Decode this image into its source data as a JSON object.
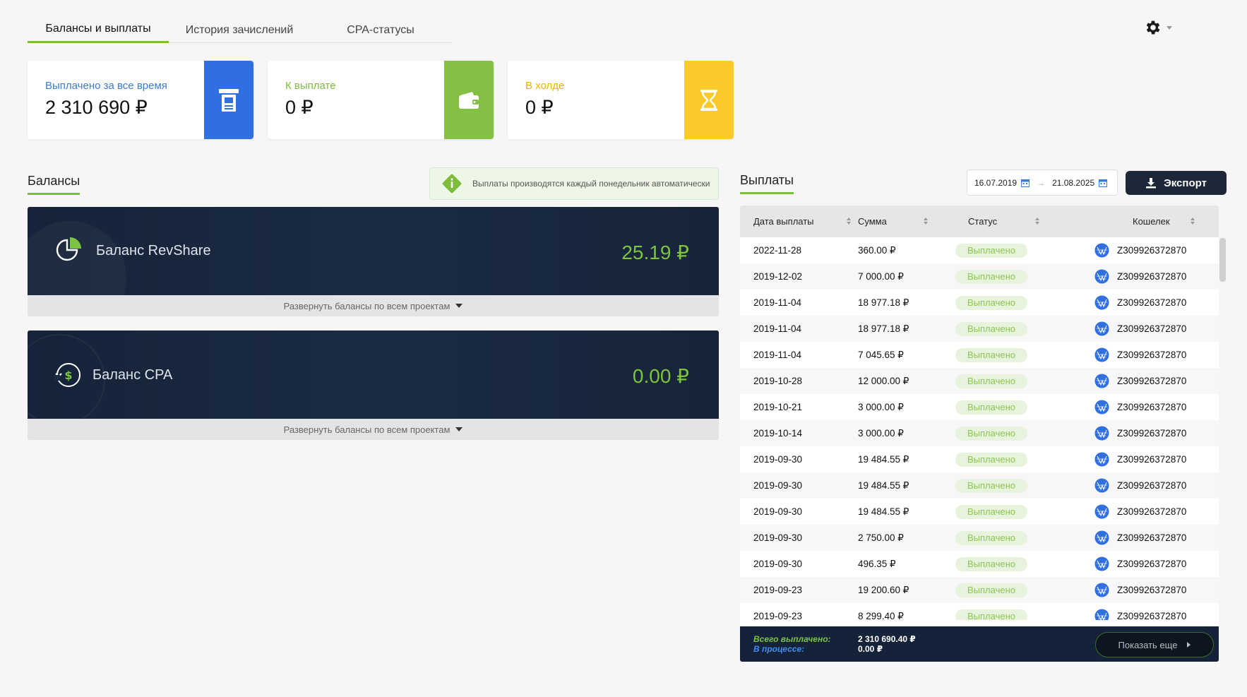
{
  "tabs": [
    {
      "label": "Балансы и выплаты",
      "active": true
    },
    {
      "label": "История зачислений",
      "active": false
    },
    {
      "label": "CPA-статусы",
      "active": false
    }
  ],
  "cards": [
    {
      "label": "Выплачено за все время",
      "value": "2 310 690 ₽",
      "label_color": "#3a7bd5",
      "icon": "atm-icon",
      "icon_bg": "#2f6fe0"
    },
    {
      "label": "К выплате",
      "value": "0 ₽",
      "label_color": "#7cbd3c",
      "icon": "wallet-icon",
      "icon_bg": "#84c043"
    },
    {
      "label": "В холде",
      "value": "0 ₽",
      "label_color": "#e6b400",
      "icon": "hourglass-icon",
      "icon_bg": "#fbc92a"
    }
  ],
  "balances_section": {
    "title": "Балансы",
    "notice": "Выплаты производятся каждый понедельник автоматически",
    "panels": [
      {
        "name": "Баланс RevShare",
        "amount": "25.19 ₽",
        "icon": "pie-chart-icon"
      },
      {
        "name": "Баланс CPA",
        "amount": "0.00 ₽",
        "icon": "dollar-refresh-icon"
      }
    ],
    "expand_label": "Развернуть балансы по всем проектам"
  },
  "payouts": {
    "title": "Выплаты",
    "date_from": "16.07.2019",
    "date_to": "21.08.2025",
    "export_label": "Экспорт",
    "columns": [
      "Дата выплаты",
      "Сумма",
      "Статус",
      "Кошелек"
    ],
    "rows": [
      {
        "date": "2022-11-28",
        "sum": "360.00 ₽",
        "status": "Выплачено",
        "wallet": "Z309926372870"
      },
      {
        "date": "2019-12-02",
        "sum": "7 000.00 ₽",
        "status": "Выплачено",
        "wallet": "Z309926372870"
      },
      {
        "date": "2019-11-04",
        "sum": "18 977.18 ₽",
        "status": "Выплачено",
        "wallet": "Z309926372870"
      },
      {
        "date": "2019-11-04",
        "sum": "18 977.18 ₽",
        "status": "Выплачено",
        "wallet": "Z309926372870"
      },
      {
        "date": "2019-11-04",
        "sum": "7 045.65 ₽",
        "status": "Выплачено",
        "wallet": "Z309926372870"
      },
      {
        "date": "2019-10-28",
        "sum": "12 000.00 ₽",
        "status": "Выплачено",
        "wallet": "Z309926372870"
      },
      {
        "date": "2019-10-21",
        "sum": "3 000.00 ₽",
        "status": "Выплачено",
        "wallet": "Z309926372870"
      },
      {
        "date": "2019-10-14",
        "sum": "3 000.00 ₽",
        "status": "Выплачено",
        "wallet": "Z309926372870"
      },
      {
        "date": "2019-09-30",
        "sum": "19 484.55 ₽",
        "status": "Выплачено",
        "wallet": "Z309926372870"
      },
      {
        "date": "2019-09-30",
        "sum": "19 484.55 ₽",
        "status": "Выплачено",
        "wallet": "Z309926372870"
      },
      {
        "date": "2019-09-30",
        "sum": "19 484.55 ₽",
        "status": "Выплачено",
        "wallet": "Z309926372870"
      },
      {
        "date": "2019-09-30",
        "sum": "2 750.00 ₽",
        "status": "Выплачено",
        "wallet": "Z309926372870"
      },
      {
        "date": "2019-09-30",
        "sum": "496.35 ₽",
        "status": "Выплачено",
        "wallet": "Z309926372870"
      },
      {
        "date": "2019-09-23",
        "sum": "19 200.60 ₽",
        "status": "Выплачено",
        "wallet": "Z309926372870"
      },
      {
        "date": "2019-09-23",
        "sum": "8 299.40 ₽",
        "status": "Выплачено",
        "wallet": "Z309926372870"
      }
    ],
    "footer": {
      "total_label": "Всего выплачено:",
      "total_value": "2 310 690.40 ₽",
      "pending_label": "В процессе:",
      "pending_value": "0.00 ₽",
      "more_label": "Показать еще"
    }
  }
}
